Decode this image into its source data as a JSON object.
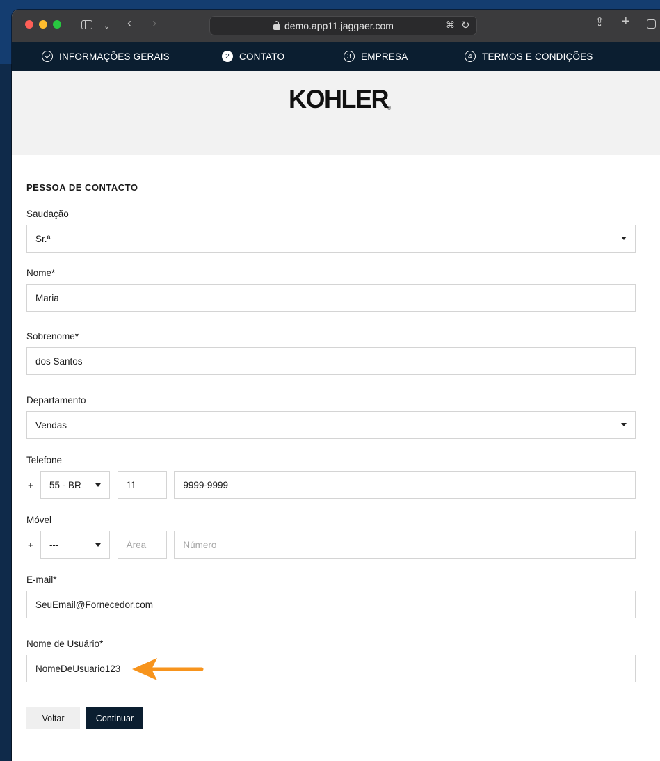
{
  "browser": {
    "url": "demo.app11.jaggaer.com"
  },
  "steps": [
    {
      "number": "",
      "label": "INFORMAÇÕES GERAIS",
      "state": "completed"
    },
    {
      "number": "2",
      "label": "CONTATO",
      "state": "active"
    },
    {
      "number": "3",
      "label": "EMPRESA",
      "state": "pending"
    },
    {
      "number": "4",
      "label": "TERMOS E CONDIÇÕES",
      "state": "pending"
    }
  ],
  "brand": {
    "logo_text": "KOHLER",
    "logo_mark": "®"
  },
  "form": {
    "section_title": "PESSOA DE CONTACTO",
    "salutation": {
      "label": "Saudação",
      "value": "Sr.ª"
    },
    "first_name": {
      "label": "Nome*",
      "value": "Maria"
    },
    "last_name": {
      "label": "Sobrenome*",
      "value": "dos Santos"
    },
    "department": {
      "label": "Departamento",
      "value": "Vendas"
    },
    "phone": {
      "label": "Telefone",
      "prefix": "+",
      "country_code": "55 - BR",
      "area": "11",
      "number": "9999-9999"
    },
    "mobile": {
      "label": "Móvel",
      "prefix": "+",
      "country_code": "---",
      "area_placeholder": "Área",
      "number_placeholder": "Número"
    },
    "email": {
      "label": "E-mail*",
      "value": "SeuEmail@Fornecedor.com"
    },
    "username": {
      "label": "Nome de Usuário*",
      "value": "NomeDeUsuario123"
    }
  },
  "buttons": {
    "back": "Voltar",
    "continue": "Continuar"
  },
  "colors": {
    "nav_bg": "#0b1e30",
    "annotation_arrow": "#f7941d"
  }
}
